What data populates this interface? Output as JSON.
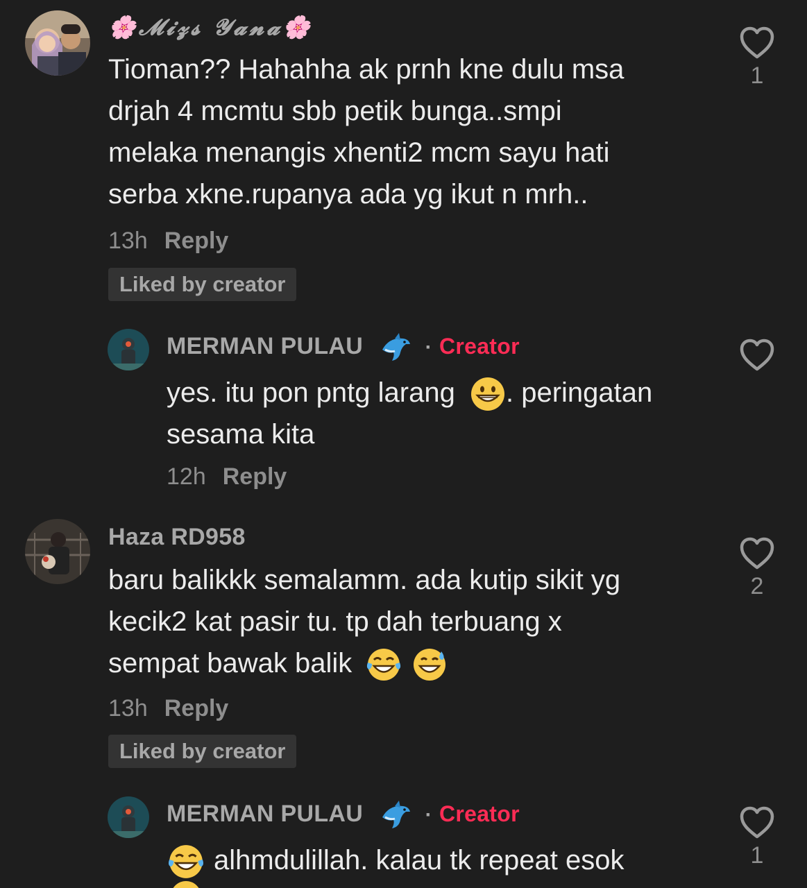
{
  "comments": [
    {
      "username": "🌸𝓜𝓲𝔃𝓼 𝓨𝓪𝓷𝓪🌸",
      "text_lines": [
        "Tioman?? Hahahha ak prnh kne dulu msa",
        "drjah 4 mcmtu sbb petik bunga..smpi",
        "melaka menangis xhenti2 mcm sayu hati",
        "serba xkne.rupanya ada yg ikut n mrh.."
      ],
      "time": "13h",
      "reply_label": "Reply",
      "liked_badge": "Liked by creator",
      "like_count": "1"
    },
    {
      "username": "MERMAN PULAU",
      "creator_label": "Creator",
      "text_lines": [
        "yes. itu pon pntg larang",
        ". peringatan",
        "sesama kita"
      ],
      "time": "12h",
      "reply_label": "Reply",
      "like_count": ""
    },
    {
      "username": "Haza RD958",
      "text_lines": [
        "baru balikkk semalamm. ada kutip sikit yg",
        "kecik2 kat pasir tu. tp dah terbuang x",
        "sempat bawak balik"
      ],
      "time": "13h",
      "reply_label": "Reply",
      "liked_badge": "Liked by creator",
      "like_count": "2"
    },
    {
      "username": "MERMAN PULAU",
      "creator_label": "Creator",
      "text_lines": [
        "alhmdulillah. kalau tk repeat esok"
      ],
      "like_count": "1"
    }
  ],
  "icons": {
    "like": "heart-outline-icon",
    "dolphin": "dolphin-emoji",
    "grin": "grinning-face-emoji",
    "tears_of_joy": "face-with-tears-of-joy-emoji",
    "sweat_smile": "grinning-face-with-sweat-emoji"
  },
  "colors": {
    "background": "#1e1e1e",
    "creator": "#fe2c55",
    "muted": "#8e8e8e",
    "text": "#ececec"
  }
}
